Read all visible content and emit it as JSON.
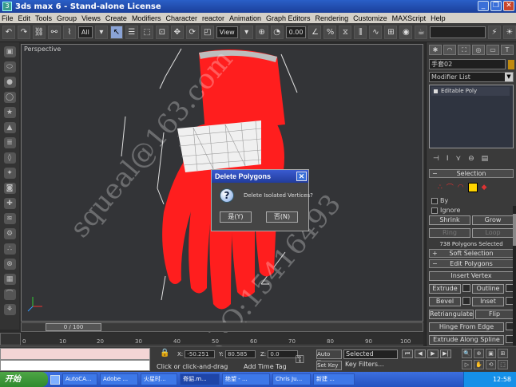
{
  "window": {
    "title": "3ds max 6 - Stand-alone License",
    "app_icon": "3ds-max-icon"
  },
  "menu": [
    "File",
    "Edit",
    "Tools",
    "Group",
    "Views",
    "Create",
    "Modifiers",
    "Character",
    "reactor",
    "Animation",
    "Graph Editors",
    "Rendering",
    "Customize",
    "MAXScript",
    "Help"
  ],
  "toolbar": {
    "filter_select": "All",
    "coord_select": "View",
    "spinner_top": "0.00",
    "spinner_bottom": "0.0"
  },
  "viewport": {
    "label": "Perspective"
  },
  "dialog": {
    "title": "Delete Polygons",
    "message": "Delete Isolated Vertices?",
    "yes_label": "是(Y)",
    "no_label": "否(N)",
    "icon": "question-icon"
  },
  "command_panel": {
    "object_name": "手套02",
    "modifier_list_label": "Modifier List",
    "stack_item": "Editable Poly",
    "selection_rollout": "Selection",
    "by_label": "By",
    "ignore_label": "Ignore",
    "shrink_label": "Shrink",
    "grow_label": "Grow",
    "ring_label": "Ring",
    "loop_label": "Loop",
    "status_text": "738 Polygons Selected",
    "soft_selection_rollout": "Soft Selection",
    "edit_polygons_rollout": "Edit Polygons",
    "insert_vertex": "Insert Vertex",
    "extrude": "Extrude",
    "outline": "Outline",
    "bevel": "Bevel",
    "inset": "Inset",
    "retriangulate": "Retriangulate",
    "flip": "Flip",
    "hinge_from_edge": "Hinge From Edge",
    "extrude_along_spline": "Extrude Along Spline"
  },
  "timeline": {
    "slider_text": "0 / 100",
    "ticks": [
      "0",
      "10",
      "20",
      "30",
      "40",
      "50",
      "60",
      "70",
      "80",
      "90",
      "100"
    ]
  },
  "status": {
    "x_label": "X:",
    "x_value": "-50.251",
    "y_label": "Y:",
    "y_value": "80.585",
    "z_label": "Z:",
    "z_value": "0.0",
    "prompt": "Click or click-and-drag",
    "add_time_tag": "Add Time Tag",
    "auto_key": "Auto Key",
    "set_key": "Set Key",
    "selected": "Selected",
    "key_filters": "Key Filters..."
  },
  "taskbar": {
    "start": "开始",
    "tasks": [
      "AutoCA...",
      "Adobe ...",
      "火星时...",
      "脊貂.m...",
      "绝望 - ...",
      "Chris Ju...",
      "新建 ..."
    ],
    "clock": "12:58"
  },
  "watermark": {
    "line1": "squeal@163.com",
    "line2": "QQ:15416493"
  },
  "colors": {
    "glove_red": "#ff1e1e",
    "selection_white": "#f0f0f0",
    "selected_yellow": "#ffd400"
  }
}
